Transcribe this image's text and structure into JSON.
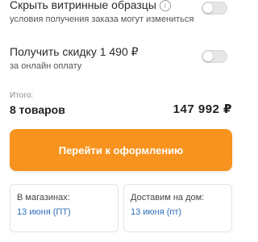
{
  "options": [
    {
      "title": "Скрыть витринные образцы",
      "subtitle": "условия получения заказа могут измениться",
      "info_icon": "info-icon",
      "info_glyph": "i",
      "toggle_on": false
    },
    {
      "title": "Получить скидку 1 490 ₽",
      "subtitle": "за онлайн оплату",
      "toggle_on": false
    }
  ],
  "summary": {
    "label": "Итого:",
    "count": "8 товаров",
    "price": "147 992 ₽"
  },
  "checkout": {
    "button_label": "Перейти к оформлению",
    "color": "#f7931e"
  },
  "delivery": [
    {
      "label": "В магазинах:",
      "value": "13 июня (ПТ)"
    },
    {
      "label": "Доставим на дом:",
      "value": "13 июня (пт)"
    }
  ],
  "colors": {
    "accent_link": "#2f6ebc",
    "toggle_off": "#e6e6e6"
  }
}
